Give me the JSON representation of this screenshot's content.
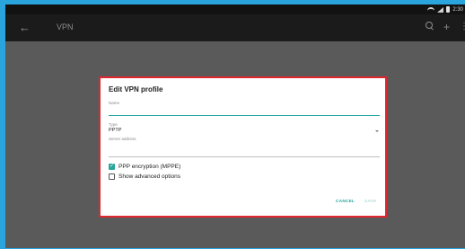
{
  "status_bar": {
    "time": "2:30",
    "icons": [
      "wifi-icon",
      "signal-icon",
      "battery-icon"
    ]
  },
  "app_bar": {
    "title": "VPN",
    "icons": [
      "back-arrow-icon",
      "search-icon",
      "add-icon",
      "more-vert-icon"
    ]
  },
  "dialog": {
    "title": "Edit VPN profile",
    "name": {
      "label": "Name",
      "value": ""
    },
    "type": {
      "label": "Type",
      "selected": "PPTP"
    },
    "server": {
      "label": "Server address",
      "value": ""
    },
    "ppp_encryption": {
      "label": "PPP encryption (MPPE)",
      "checked": true
    },
    "advanced": {
      "label": "Show advanced options",
      "checked": false
    },
    "cancel_label": "CANCEL",
    "save_label": "SAVE"
  },
  "colors": {
    "accent": "#26a69a",
    "highlight_border": "#e1262f",
    "frame": "#29a4dd",
    "scrim": "#5a5a5a",
    "app_bar": "#1b1b1b"
  }
}
